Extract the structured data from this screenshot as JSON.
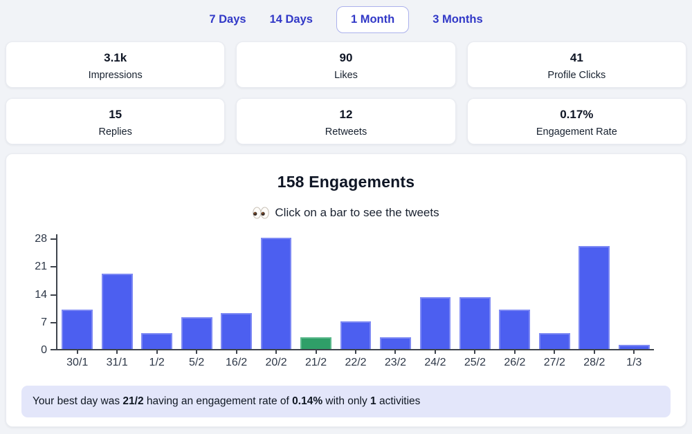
{
  "tabs": {
    "items": [
      {
        "label": "7 Days",
        "active": false
      },
      {
        "label": "14 Days",
        "active": false
      },
      {
        "label": "1 Month",
        "active": true
      },
      {
        "label": "3 Months",
        "active": false
      }
    ]
  },
  "stats": [
    {
      "value": "3.1k",
      "label": "Impressions"
    },
    {
      "value": "90",
      "label": "Likes"
    },
    {
      "value": "41",
      "label": "Profile Clicks"
    },
    {
      "value": "15",
      "label": "Replies"
    },
    {
      "value": "12",
      "label": "Retweets"
    },
    {
      "value": "0.17%",
      "label": "Engagement Rate"
    }
  ],
  "chart_data": {
    "type": "bar",
    "title": "158 Engagements",
    "subtitle_icon": "eyes-emoji",
    "subtitle": "Click on a bar to see the tweets",
    "categories": [
      "30/1",
      "31/1",
      "1/2",
      "5/2",
      "16/2",
      "20/2",
      "21/2",
      "22/2",
      "23/2",
      "24/2",
      "25/2",
      "26/2",
      "27/2",
      "28/2",
      "1/3"
    ],
    "values": [
      10,
      19,
      4,
      8,
      9,
      28,
      3,
      7,
      3,
      13,
      13,
      10,
      4,
      26,
      1
    ],
    "total_engagements": 158,
    "yticks": [
      0,
      7,
      14,
      21,
      28
    ],
    "ylim": [
      0,
      28
    ],
    "grid": false,
    "legend": false,
    "highlight_category": "21/2",
    "colors": {
      "bar": "#4c5ff0",
      "bar_border": "#7d89f4",
      "highlight": "#2f9f68",
      "highlight_border": "#5cb98c"
    }
  },
  "note": {
    "prefix": "Your best day was ",
    "best_day": "21/2",
    "mid1": " having an engagement rate of ",
    "rate": "0.14%",
    "mid2": " with only ",
    "count": "1",
    "suffix": " activities"
  }
}
